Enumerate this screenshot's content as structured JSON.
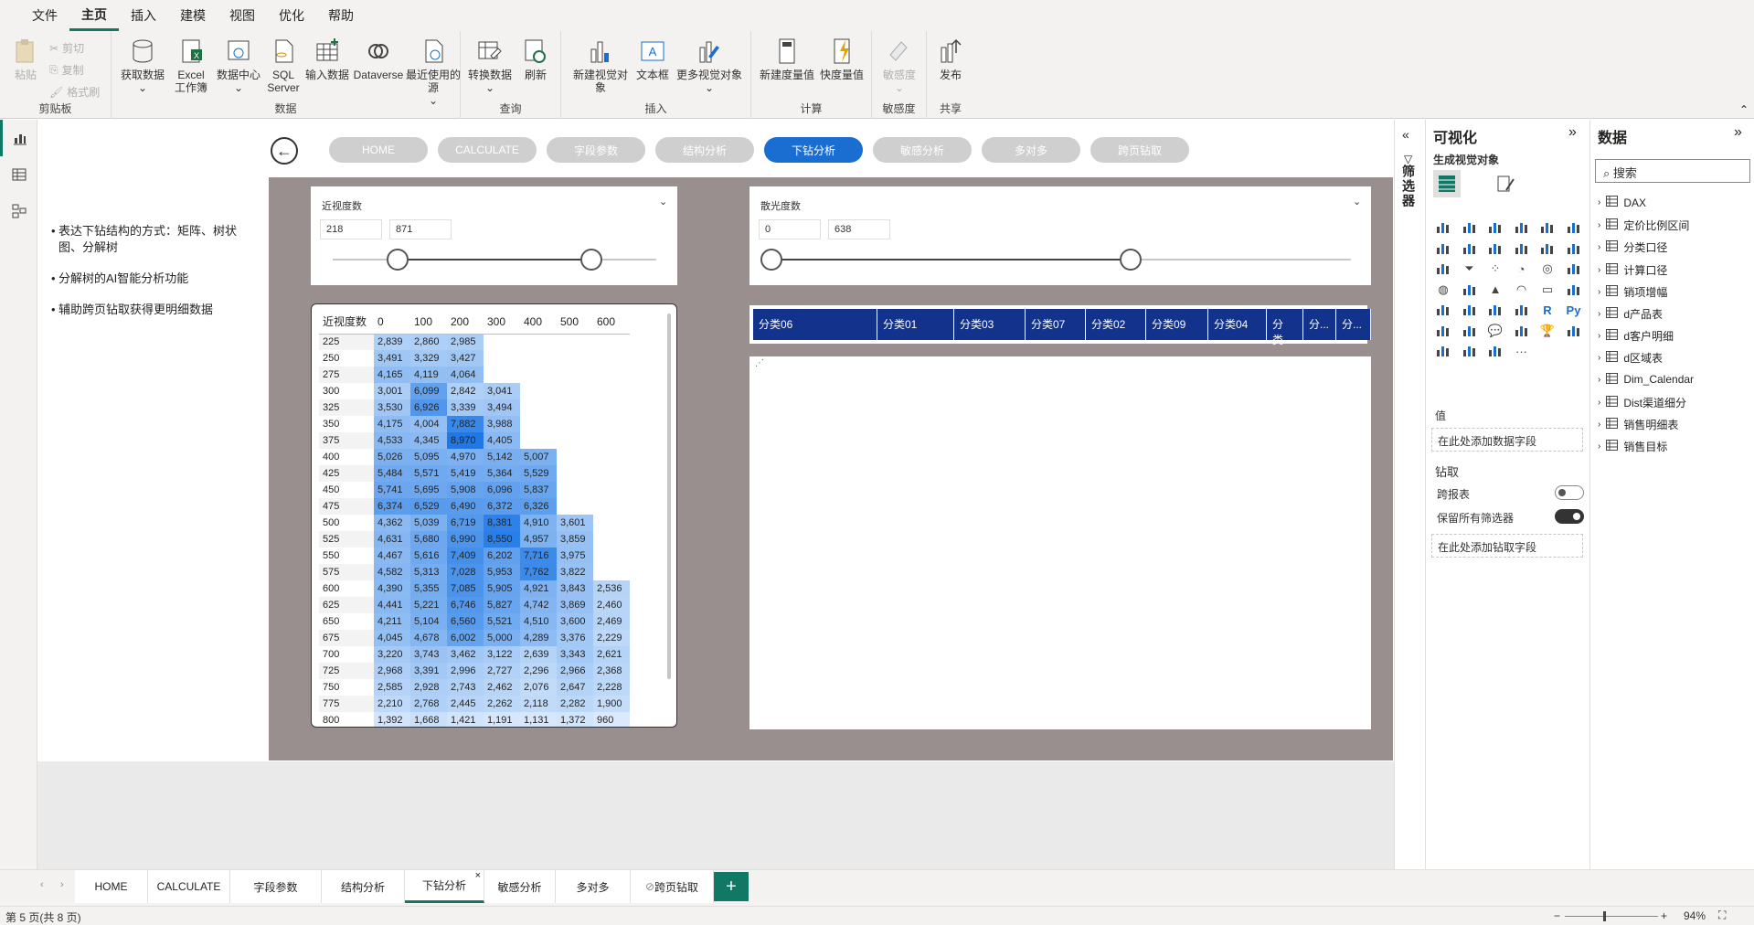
{
  "menu": [
    "文件",
    "主页",
    "插入",
    "建模",
    "视图",
    "优化",
    "帮助"
  ],
  "menu_active": 1,
  "ribbon": {
    "clipboard": {
      "paste": "粘贴",
      "cut": "剪切",
      "copy": "复制",
      "format": "格式刷",
      "label": "剪贴板"
    },
    "data": {
      "get": "获取数据",
      "excel1": "Excel",
      "excel2": "工作簿",
      "hub": "数据中心",
      "sql1": "SQL",
      "sql2": "Server",
      "enter": "输入数据",
      "dataverse": "Dataverse",
      "recent": "最近使用的源",
      "label": "数据"
    },
    "query": {
      "transform": "转换数据",
      "refresh": "刷新",
      "label": "查询"
    },
    "insert": {
      "newvis": "新建视觉对象",
      "textbox": "文本框",
      "morevis": "更多视觉对象",
      "label": "插入"
    },
    "calc": {
      "newmeasure": "新建度量值",
      "quick": "快度量值",
      "label": "计算"
    },
    "sens": {
      "sens": "敏感度",
      "label": "敏感度"
    },
    "share": {
      "publish": "发布",
      "label": "共享"
    }
  },
  "left_notes": [
    "表达下钻结构的方式：矩阵、树状图、分解树",
    "分解树的AI智能分析功能",
    "辅助跨页钻取获得更明细数据"
  ],
  "nav_buttons": [
    "HOME",
    "CALCULATE",
    "字段参数",
    "结构分析",
    "下钻分析",
    "敏感分析",
    "多对多",
    "跨页钻取"
  ],
  "nav_active": 4,
  "slicer1": {
    "title": "近视度数",
    "min": "218",
    "max": "871",
    "lo": 0.2,
    "hi": 0.8
  },
  "slicer2": {
    "title": "散光度数",
    "min": "0",
    "max": "638",
    "lo": 0.0,
    "hi": 0.62
  },
  "matrix": {
    "corner": "近视度数",
    "cols": [
      "0",
      "100",
      "200",
      "300",
      "400",
      "500",
      "600"
    ],
    "rows": [
      {
        "h": "225",
        "v": [
          "2,839",
          "2,860",
          "2,985",
          "",
          "",
          "",
          ""
        ]
      },
      {
        "h": "250",
        "v": [
          "3,491",
          "3,329",
          "3,427",
          "",
          "",
          "",
          ""
        ]
      },
      {
        "h": "275",
        "v": [
          "4,165",
          "4,119",
          "4,064",
          "",
          "",
          "",
          ""
        ]
      },
      {
        "h": "300",
        "v": [
          "3,001",
          "6,099",
          "2,842",
          "3,041",
          "",
          "",
          ""
        ]
      },
      {
        "h": "325",
        "v": [
          "3,530",
          "6,926",
          "3,339",
          "3,494",
          "",
          "",
          ""
        ]
      },
      {
        "h": "350",
        "v": [
          "4,175",
          "4,004",
          "7,882",
          "3,988",
          "",
          "",
          ""
        ]
      },
      {
        "h": "375",
        "v": [
          "4,533",
          "4,345",
          "8,970",
          "4,405",
          "",
          "",
          ""
        ]
      },
      {
        "h": "400",
        "v": [
          "5,026",
          "5,095",
          "4,970",
          "5,142",
          "5,007",
          "",
          ""
        ]
      },
      {
        "h": "425",
        "v": [
          "5,484",
          "5,571",
          "5,419",
          "5,364",
          "5,529",
          "",
          ""
        ]
      },
      {
        "h": "450",
        "v": [
          "5,741",
          "5,695",
          "5,908",
          "6,096",
          "5,837",
          "",
          ""
        ]
      },
      {
        "h": "475",
        "v": [
          "6,374",
          "6,529",
          "6,490",
          "6,372",
          "6,326",
          "",
          ""
        ]
      },
      {
        "h": "500",
        "v": [
          "4,362",
          "5,039",
          "6,719",
          "8,381",
          "4,910",
          "3,601",
          ""
        ]
      },
      {
        "h": "525",
        "v": [
          "4,631",
          "5,680",
          "6,990",
          "8,550",
          "4,957",
          "3,859",
          ""
        ]
      },
      {
        "h": "550",
        "v": [
          "4,467",
          "5,616",
          "7,409",
          "6,202",
          "7,716",
          "3,975",
          ""
        ]
      },
      {
        "h": "575",
        "v": [
          "4,582",
          "5,313",
          "7,028",
          "5,953",
          "7,762",
          "3,822",
          ""
        ]
      },
      {
        "h": "600",
        "v": [
          "4,390",
          "5,355",
          "7,085",
          "5,905",
          "4,921",
          "3,843",
          "2,536"
        ]
      },
      {
        "h": "625",
        "v": [
          "4,441",
          "5,221",
          "6,746",
          "5,827",
          "4,742",
          "3,869",
          "2,460"
        ]
      },
      {
        "h": "650",
        "v": [
          "4,211",
          "5,104",
          "6,560",
          "5,521",
          "4,510",
          "3,600",
          "2,469"
        ]
      },
      {
        "h": "675",
        "v": [
          "4,045",
          "4,678",
          "6,002",
          "5,000",
          "4,289",
          "3,376",
          "2,229"
        ]
      },
      {
        "h": "700",
        "v": [
          "3,220",
          "3,743",
          "3,462",
          "3,122",
          "2,639",
          "3,343",
          "2,621"
        ]
      },
      {
        "h": "725",
        "v": [
          "2,968",
          "3,391",
          "2,996",
          "2,727",
          "2,296",
          "2,966",
          "2,368"
        ]
      },
      {
        "h": "750",
        "v": [
          "2,585",
          "2,928",
          "2,743",
          "2,462",
          "2,076",
          "2,647",
          "2,228"
        ]
      },
      {
        "h": "775",
        "v": [
          "2,210",
          "2,768",
          "2,445",
          "2,262",
          "2,118",
          "2,282",
          "1,900"
        ]
      },
      {
        "h": "800",
        "v": [
          "1,392",
          "1,668",
          "1,421",
          "1,191",
          "1,131",
          "1,372",
          "960"
        ]
      }
    ]
  },
  "col_headers": [
    "分类06",
    "分类01",
    "分类03",
    "分类07",
    "分类02",
    "分类09",
    "分类04",
    "分类...",
    "分...",
    "分..."
  ],
  "vis_pane": {
    "title": "可视化",
    "subtitle": "生成视觉对象",
    "values": "值",
    "values_drop": "在此处添加数据字段",
    "drill": "钻取",
    "cross": "跨报表",
    "keep": "保留所有筛选器",
    "drill_drop": "在此处添加钻取字段"
  },
  "filter_title": "筛选器",
  "data_pane": {
    "title": "数据",
    "search": "搜索",
    "items": [
      "DAX",
      "定价比例区间",
      "分类口径",
      "计算口径",
      "销项增幅",
      "d产品表",
      "d客户明细",
      "d区域表",
      "Dim_Calendar",
      "Dist渠道细分",
      "销售明细表",
      "销售目标"
    ]
  },
  "tabs": [
    "HOME",
    "CALCULATE",
    "字段参数",
    "结构分析",
    "下钻分析",
    "敏感分析",
    "多对多",
    "跨页钻取"
  ],
  "tab_active": 4,
  "status": {
    "page": "第 5 页(共 8 页)",
    "zoom": "94%"
  }
}
